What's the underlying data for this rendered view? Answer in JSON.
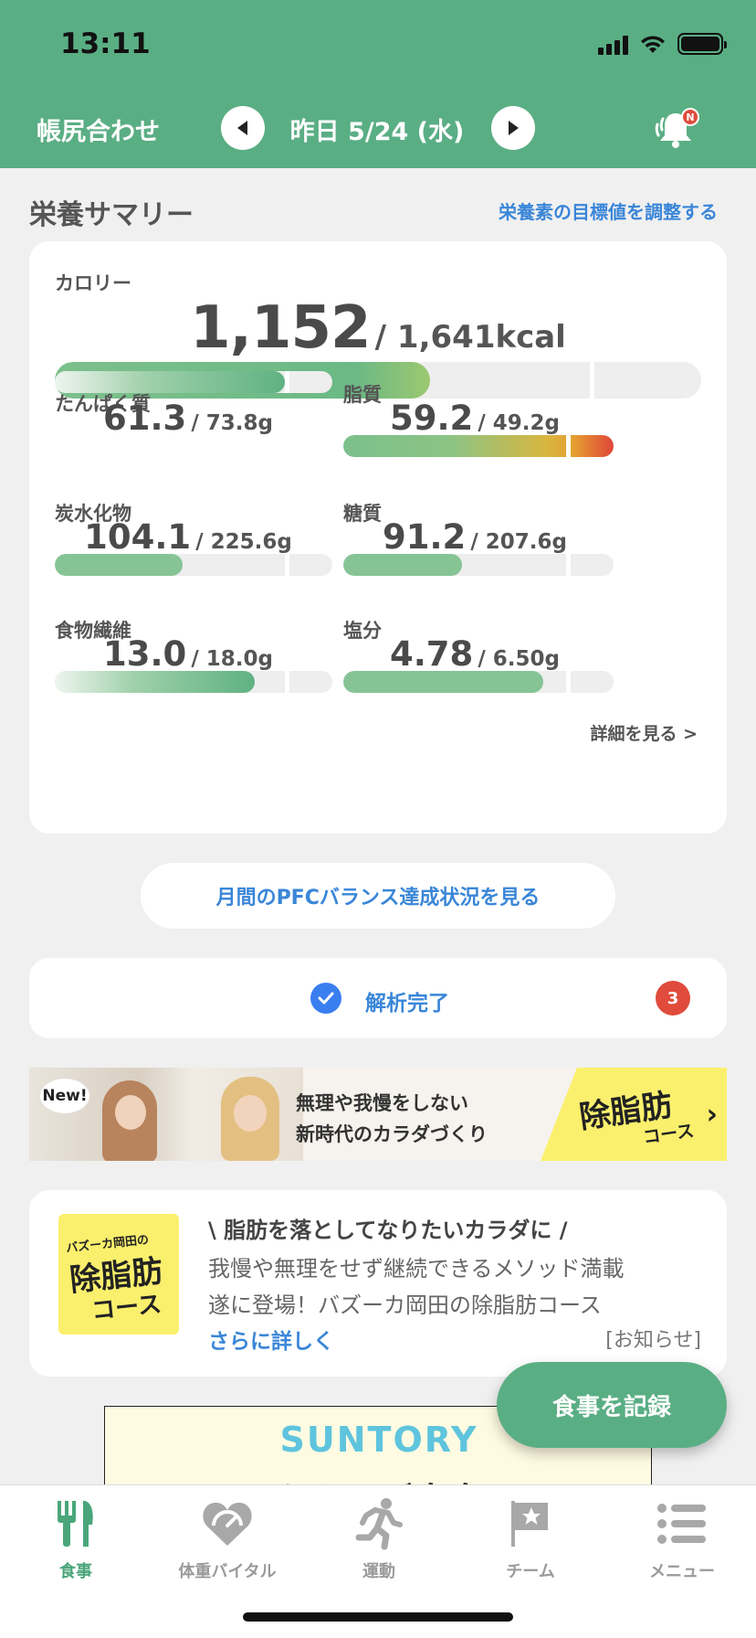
{
  "status": {
    "time": "13:11"
  },
  "header": {
    "left_title": "帳尻合わせ",
    "date": "昨日 5/24 (水)",
    "bell_badge": "N"
  },
  "summary": {
    "title": "栄養サマリー",
    "adjust_link": "栄養素の目標値を調整する",
    "calorie": {
      "label": "カロリー",
      "value": "1,152",
      "target": "/ 1,641kcal",
      "ratio": 0.7
    },
    "nutrients": [
      {
        "label": "たんぱく質",
        "value": "61.3",
        "target": "/ 73.8g",
        "ratio": 0.83,
        "color": "#6fba8a"
      },
      {
        "label": "脂質",
        "value": "59.2",
        "target": "/ 49.2g",
        "ratio": 1.2,
        "color": "#e0a030"
      },
      {
        "label": "炭水化物",
        "value": "104.1",
        "target": "/ 225.6g",
        "ratio": 0.46,
        "color": "#86c496"
      },
      {
        "label": "糖質",
        "value": "91.2",
        "target": "/ 207.6g",
        "ratio": 0.44,
        "color": "#86c496"
      },
      {
        "label": "食物繊維",
        "value": "13.0",
        "target": "/ 18.0g",
        "ratio": 0.72,
        "color": "#6fba8a"
      },
      {
        "label": "塩分",
        "value": "4.78",
        "target": "/ 6.50g",
        "ratio": 0.74,
        "color": "#86c496"
      }
    ],
    "detail_link": "詳細を見る >"
  },
  "pfc_button": "月間のPFCバランス達成状況を見る",
  "analysis": {
    "label": "解析完了",
    "count": "3"
  },
  "banner": {
    "new": "New!",
    "line1": "無理や我慢をしない",
    "line2": "新時代のカラダづくり",
    "course_big": "除脂肪",
    "course_small": "コース"
  },
  "news": {
    "thumb_small": "バズーカ岡田の",
    "thumb_big": "除脂肪",
    "thumb_course": "コース",
    "headline": "\\ 脂肪を落としてなりたいカラダに /",
    "body_line1": "我慢や無理をせず継続できるメソッド満載",
    "body_line2": "遂に登場！バズーカ岡田の除脂肪コース",
    "more": "さらに詳しく",
    "tag": "[お知らせ]"
  },
  "record_button": "食事を記録",
  "ad": {
    "brand": "SUNTORY",
    "copy": "あなたはご自身を"
  },
  "tabs": [
    {
      "label": "食事",
      "icon": "fork-knife-icon",
      "active": true
    },
    {
      "label": "体重バイタル",
      "icon": "heart-gauge-icon",
      "active": false
    },
    {
      "label": "運動",
      "icon": "runner-icon",
      "active": false
    },
    {
      "label": "チーム",
      "icon": "flag-star-icon",
      "active": false
    },
    {
      "label": "メニュー",
      "icon": "menu-list-icon",
      "active": false
    }
  ]
}
